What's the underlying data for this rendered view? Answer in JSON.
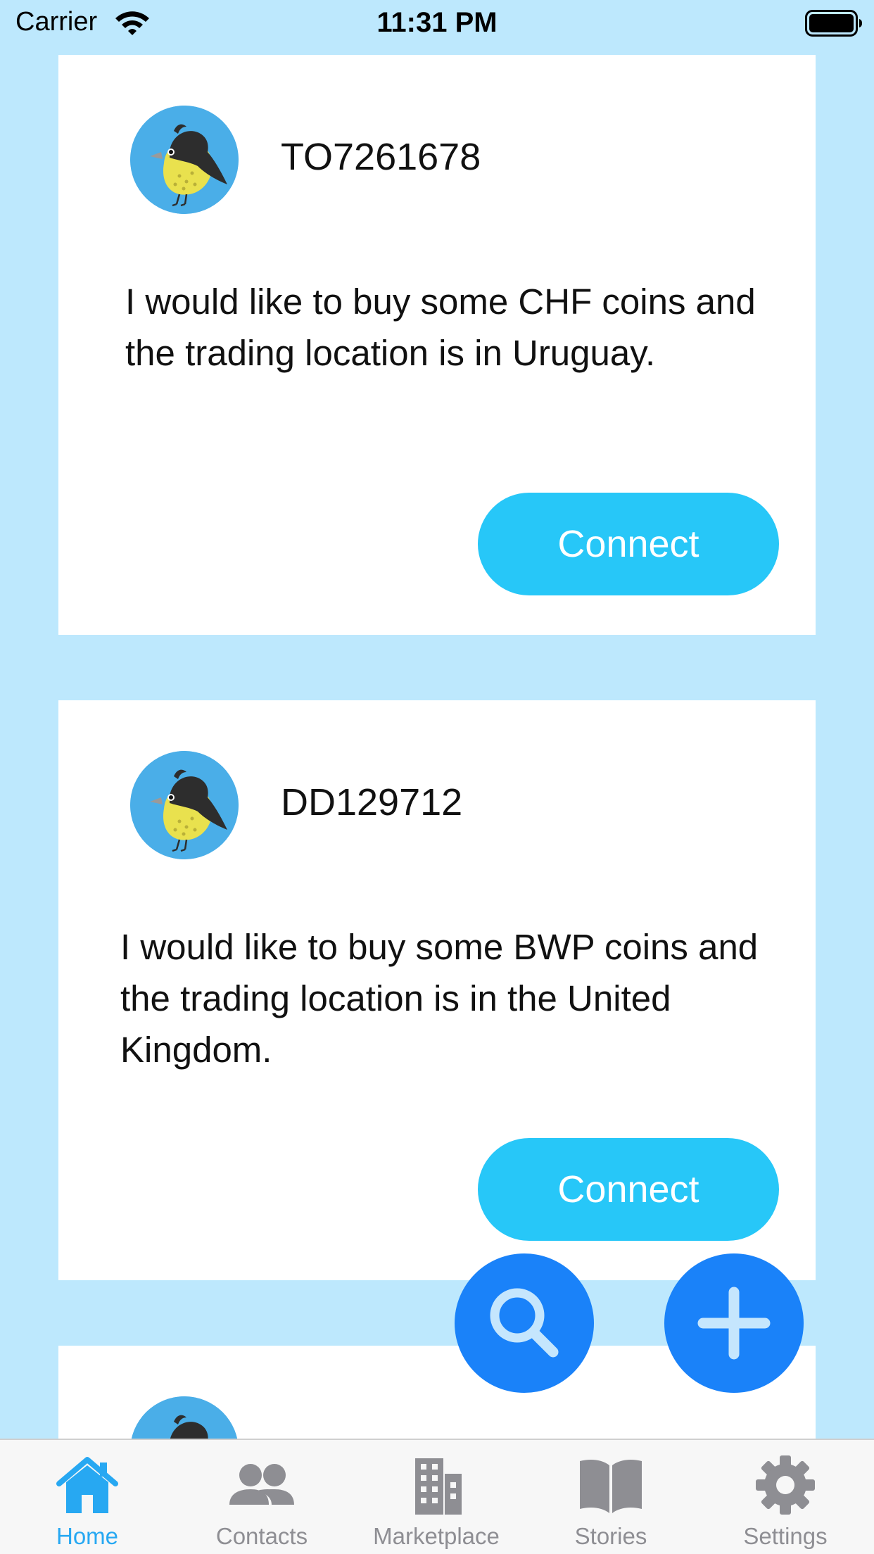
{
  "status_bar": {
    "carrier": "Carrier",
    "time": "11:31 PM"
  },
  "feed": {
    "cards": [
      {
        "username": "TO7261678",
        "message": "I would like to buy some CHF coins and the trading location is in Uruguay.",
        "connect_label": "Connect"
      },
      {
        "username": "DD129712",
        "message": "I would like to buy some BWP coins and the trading location is in the United Kingdom.",
        "connect_label": "Connect"
      }
    ]
  },
  "fabs": {
    "search_icon": "search-icon",
    "add_icon": "plus-icon"
  },
  "tab_bar": {
    "active_tab": "home",
    "items": [
      {
        "id": "home",
        "label": "Home",
        "icon": "home-icon"
      },
      {
        "id": "contacts",
        "label": "Contacts",
        "icon": "people-icon"
      },
      {
        "id": "marketplace",
        "label": "Marketplace",
        "icon": "building-icon"
      },
      {
        "id": "stories",
        "label": "Stories",
        "icon": "book-icon"
      },
      {
        "id": "settings",
        "label": "Settings",
        "icon": "gear-icon"
      }
    ]
  },
  "colors": {
    "background": "#bde8fd",
    "card": "#ffffff",
    "connect_button": "#27c7f8",
    "fab": "#1a82f9",
    "tab_active": "#27a8f2",
    "tab_inactive": "#8e8e93"
  }
}
